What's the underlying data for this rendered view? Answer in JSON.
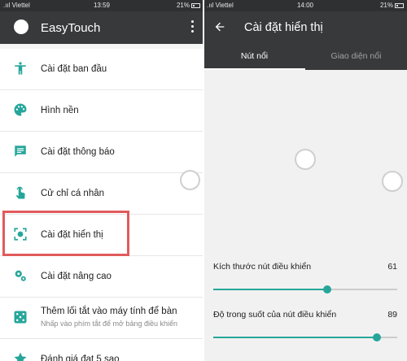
{
  "left": {
    "status": {
      "carrier": ".ııl Viettel",
      "time": "13:59",
      "battery": "21%"
    },
    "app_title": "EasyTouch",
    "menu": [
      {
        "label": "Cài đặt ban đầu",
        "icon": "person-accessibility-icon"
      },
      {
        "label": "Hình nền",
        "icon": "palette-icon"
      },
      {
        "label": "Cài đặt thông báo",
        "icon": "chat-message-icon"
      },
      {
        "label": "Cử chỉ cá nhân",
        "icon": "touch-gesture-icon"
      },
      {
        "label": "Cài đặt hiển thị",
        "icon": "center-focus-icon"
      },
      {
        "label": "Cài đặt nâng cao",
        "icon": "settings-gears-icon"
      },
      {
        "label": "Thêm lối tắt vào máy tính để bàn",
        "sub": "Nhấp vào phím tắt để mở bảng điều khiển",
        "icon": "dice-icon"
      },
      {
        "label": "Đánh giá đạt 5 sao",
        "icon": "star-icon"
      }
    ],
    "highlight_color": "#e15b5b"
  },
  "right": {
    "status": {
      "carrier": ".ııl Viettel",
      "time": "14:00",
      "battery": "21%"
    },
    "title": "Cài đặt hiển thị",
    "tabs": [
      "Nút nổi",
      "Giao diện nổi"
    ],
    "sliders": [
      {
        "label": "Kích thước nút điều khiển",
        "value": "61",
        "fraction": 0.62
      },
      {
        "label": "Độ trong suốt của nút điều khiển",
        "value": "89",
        "fraction": 0.89
      }
    ],
    "accent": "#26a69a"
  }
}
